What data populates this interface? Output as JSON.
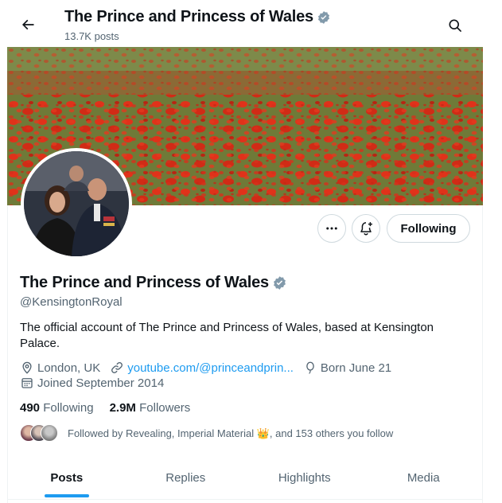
{
  "header": {
    "title": "The Prince and Princess of Wales",
    "posts_count": "13.7K posts"
  },
  "profile": {
    "name": "The Prince and Princess of Wales",
    "handle": "@KensingtonRoyal",
    "bio": "The official account of The Prince and Princess of Wales, based at Kensington Palace.",
    "location": "London, UK",
    "website": "youtube.com/@princeandprin...",
    "birthday": "Born June 21",
    "joined": "Joined September 2014"
  },
  "actions": {
    "following_label": "Following"
  },
  "stats": {
    "following_count": "490",
    "following_label": "Following",
    "followers_count": "2.9M",
    "followers_label": "Followers"
  },
  "followed_by": {
    "text": "Followed by Revealing, Imperial Material 👑, and 153 others you follow"
  },
  "tabs": [
    {
      "label": "Posts",
      "active": true
    },
    {
      "label": "Replies",
      "active": false
    },
    {
      "label": "Highlights",
      "active": false
    },
    {
      "label": "Media",
      "active": false
    }
  ],
  "colors": {
    "accent": "#1d9bf0",
    "verified_badge": "#829aab",
    "secondary_text": "#536471"
  }
}
